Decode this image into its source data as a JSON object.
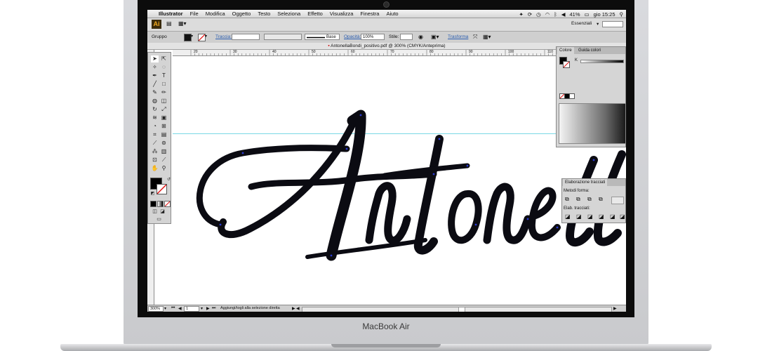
{
  "device": {
    "brand_label": "MacBook Air"
  },
  "menubar": {
    "apple": "",
    "app_name": "Illustrator",
    "items": [
      "File",
      "Modifica",
      "Oggetto",
      "Testo",
      "Seleziona",
      "Effetto",
      "Visualizza",
      "Finestra",
      "Aiuto"
    ],
    "battery": "41%",
    "clock": "gio 15:25"
  },
  "appbar": {
    "logo": "Ai",
    "workspace": "Essenziali"
  },
  "control_bar": {
    "selection_type": "Gruppo",
    "stroke_label": "Traccia:",
    "brush_value": "Base",
    "opacity_label": "Opacità:",
    "opacity_value": "100%",
    "style_label": "Stile:",
    "transform_label": "Trasforma"
  },
  "document": {
    "tab_title": "AntonellaBondi_positivo.pdf @ 300% (CMYK/Anteprima)"
  },
  "ruler": {
    "ticks": [
      "20",
      "30",
      "40",
      "50",
      "60",
      "70",
      "80",
      "90",
      "100",
      "110",
      "120",
      "130"
    ]
  },
  "color_panel": {
    "tab_active": "Colore",
    "tab_other": "Guida colori",
    "channel": "K"
  },
  "path_panel": {
    "title": "Elaborazione tracciati",
    "shape_modes": "Metodi forma:",
    "pathfinders": "Elab. tracciati:"
  },
  "status_bar": {
    "zoom": "300%",
    "page": "1",
    "hint": "Aggiungi/togli alla selezione diretta"
  },
  "colors": {
    "accent_ai": "#f0a81e",
    "guide": "#7ad8e6",
    "link": "#2a5db0"
  }
}
